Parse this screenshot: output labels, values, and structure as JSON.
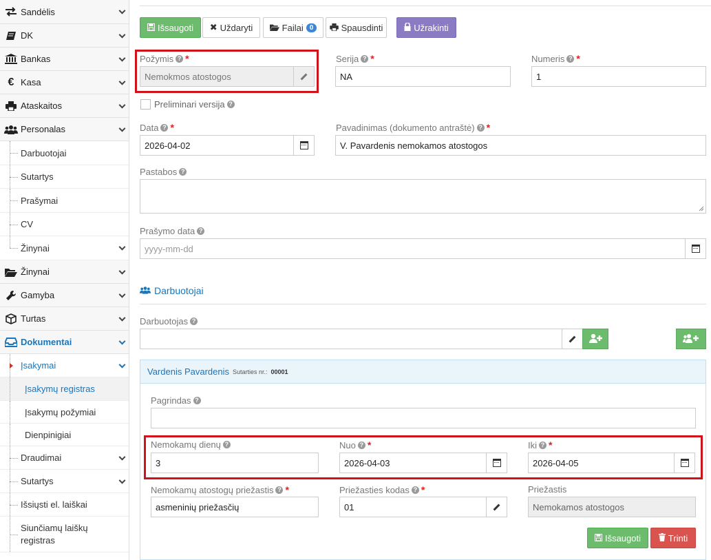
{
  "sidebar": {
    "items": [
      {
        "label": "Sandėlis",
        "icon": "exchange-icon"
      },
      {
        "label": "DK",
        "icon": "book-icon"
      },
      {
        "label": "Bankas",
        "icon": "bank-icon"
      },
      {
        "label": "Kasa",
        "icon": "euro-icon"
      },
      {
        "label": "Ataskaitos",
        "icon": "print-icon"
      },
      {
        "label": "Personalas",
        "icon": "users-icon"
      }
    ],
    "personalas_sub": [
      "Darbuotojai",
      "Sutartys",
      "Prašymai",
      "CV",
      "Žinynai"
    ],
    "items2": [
      {
        "label": "Žinynai",
        "icon": "folder-open-icon"
      },
      {
        "label": "Gamyba",
        "icon": "wrench-icon"
      },
      {
        "label": "Turtas",
        "icon": "cube-icon"
      },
      {
        "label": "Dokumentai",
        "icon": "inbox-icon"
      }
    ],
    "dok_sub": {
      "isakymai": "Įsakymai",
      "isakymai_sub": [
        "Įsakymų registras",
        "Įsakymų požymiai",
        "Dienpinigiai"
      ],
      "rest": [
        "Draudimai",
        "Sutartys",
        "Išsiųsti el. laiškai",
        "Siunčiamų laiškų registras"
      ]
    }
  },
  "toolbar": {
    "save": "Išsaugoti",
    "close": "Uždaryti",
    "files": "Failai",
    "files_count": "0",
    "print": "Spausdinti",
    "lock": "Užrakinti"
  },
  "form": {
    "pozymis_label": "Požymis",
    "pozymis_value": "Nemokmos atostogos",
    "serija_label": "Serija",
    "serija_value": "NA",
    "numeris_label": "Numeris",
    "numeris_value": "1",
    "preliminari_label": "Preliminari versija",
    "data_label": "Data",
    "data_value": "2026-04-02",
    "pavadinimas_label": "Pavadinimas (dokumento antraštė)",
    "pavadinimas_value": "V. Pavardenis nemokamos atostogos",
    "pastabos_label": "Pastabos",
    "prasymo_data_label": "Prašymo data",
    "prasymo_data_placeholder": "yyyy-mm-dd"
  },
  "employees": {
    "section_title": "Darbuotojai",
    "darbuotojas_label": "Darbuotojas",
    "panel": {
      "name": "Vardenis Pavardenis",
      "contract_label": "Sutarties nr.:",
      "contract_no": "00001",
      "pagrindas_label": "Pagrindas",
      "dienu_label": "Nemokamų dienų",
      "dienu_value": "3",
      "nuo_label": "Nuo",
      "nuo_value": "2026-04-03",
      "iki_label": "Iki",
      "iki_value": "2026-04-05",
      "priezastis_label": "Nemokamų atostogų priežastis",
      "priezastis_value": "asmeninių priežasčių",
      "kodas_label": "Priežasties kodas",
      "kodas_value": "01",
      "priezastis2_label": "Priežastis",
      "priezastis2_value": "Nemokamos atostogos",
      "save": "Išsaugoti",
      "delete": "Trinti"
    }
  }
}
